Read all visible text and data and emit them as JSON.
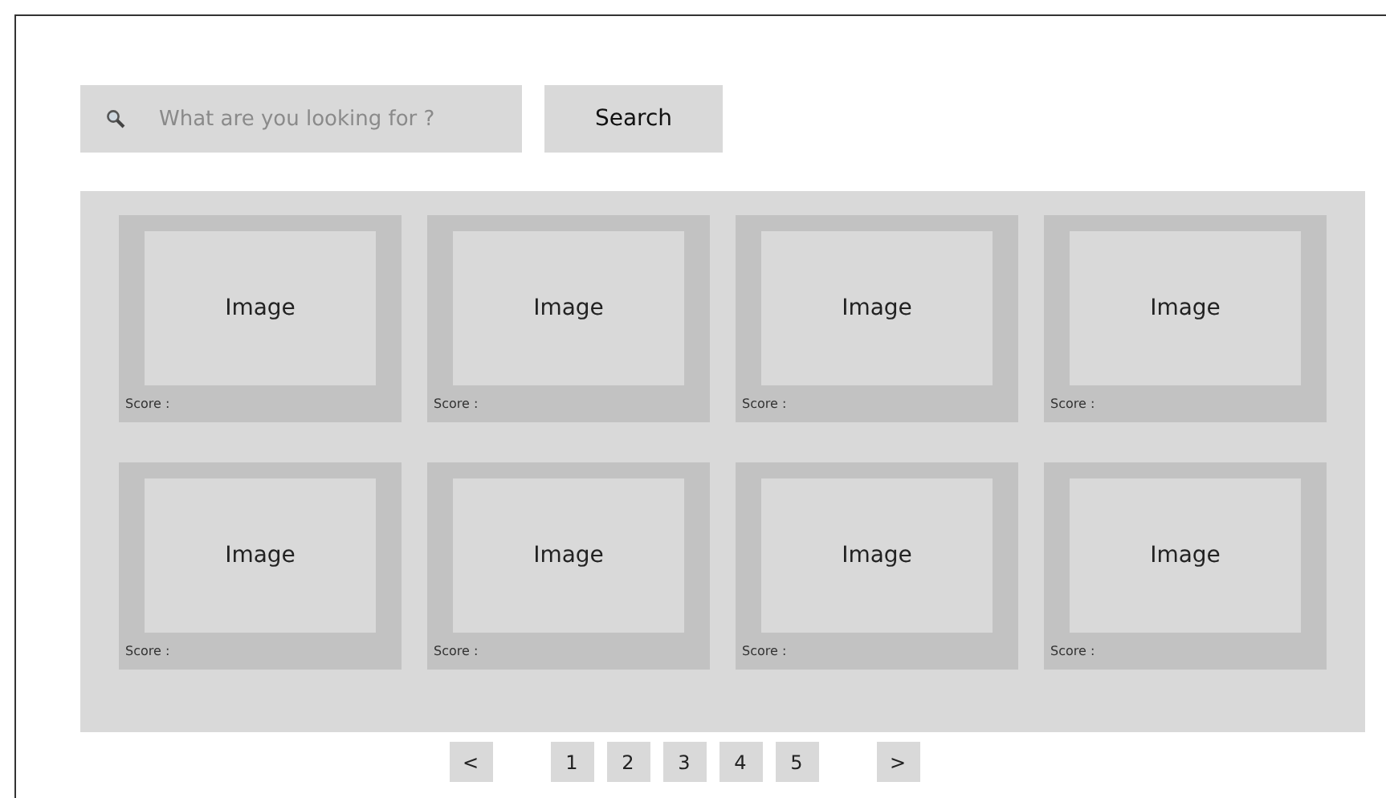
{
  "search": {
    "placeholder": "What are you looking for ?",
    "button": "Search"
  },
  "results": [
    {
      "image": "Image",
      "score": "Score :"
    },
    {
      "image": "Image",
      "score": "Score :"
    },
    {
      "image": "Image",
      "score": "Score :"
    },
    {
      "image": "Image",
      "score": "Score :"
    },
    {
      "image": "Image",
      "score": "Score :"
    },
    {
      "image": "Image",
      "score": "Score :"
    },
    {
      "image": "Image",
      "score": "Score :"
    },
    {
      "image": "Image",
      "score": "Score :"
    }
  ],
  "pagination": {
    "previous": "<",
    "pages": [
      "1",
      "2",
      "3",
      "4",
      "5"
    ],
    "next": ">"
  }
}
